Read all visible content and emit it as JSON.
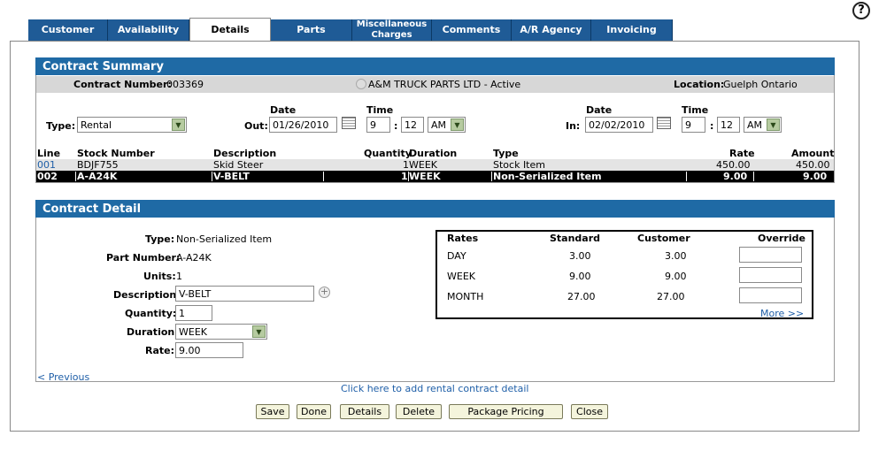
{
  "tabs": [
    {
      "label": "Customer"
    },
    {
      "label": "Availability"
    },
    {
      "label": "Details"
    },
    {
      "label": "Parts"
    },
    {
      "label_line1": "Miscellaneous",
      "label_line2": "Charges"
    },
    {
      "label": "Comments"
    },
    {
      "label": "A/R Agency"
    },
    {
      "label": "Invoicing"
    }
  ],
  "help_icon": "?",
  "summary": {
    "title": "Contract Summary",
    "contract_number_label": "Contract Number:",
    "contract_number": "003369",
    "customer": "A&M TRUCK PARTS LTD - Active",
    "location_label": "Location:",
    "location": "Guelph Ontario",
    "type_label": "Type:",
    "type_value": "Rental",
    "date_header": "Date",
    "time_header": "Time",
    "out_label": "Out:",
    "out_date": "01/26/2010",
    "out_hour": "9",
    "out_min": "12",
    "out_ampm": "AM",
    "in_label": "In:",
    "in_date": "02/02/2010",
    "in_hour": "9",
    "in_min": "12",
    "in_ampm": "AM",
    "colon": ":"
  },
  "lines": {
    "headers": {
      "line": "Line",
      "stock": "Stock Number",
      "desc": "Description",
      "qty": "Quantity",
      "duration": "Duration",
      "type": "Type",
      "rate": "Rate",
      "amount": "Amount"
    },
    "rows": [
      {
        "line": "001",
        "stock": "BDJF755",
        "desc": "Skid Steer",
        "qty": "1",
        "duration": "WEEK",
        "type": "Stock Item",
        "rate": "450.00",
        "amount": "450.00"
      },
      {
        "line": "002",
        "stock": "A-A24K",
        "desc": "V-BELT",
        "qty": "1",
        "duration": "WEEK",
        "type": "Non-Serialized Item",
        "rate": "9.00",
        "amount": "9.00"
      }
    ]
  },
  "detail": {
    "title": "Contract Detail",
    "type_label": "Type:",
    "type_value": "Non-Serialized Item",
    "part_label": "Part Number:",
    "part_value": "A-A24K",
    "units_label": "Units:",
    "units_value": "1",
    "desc_label": "Description:",
    "desc_value": "V-BELT",
    "qty_label": "Quantity:",
    "qty_value": "1",
    "duration_label": "Duration:",
    "duration_value": "WEEK",
    "rate_label": "Rate:",
    "rate_value": "9.00",
    "previous_link": "< Previous",
    "add_link": "Click here to add rental contract detail"
  },
  "rates": {
    "headers": {
      "rates": "Rates",
      "standard": "Standard",
      "customer": "Customer",
      "override": "Override"
    },
    "rows": [
      {
        "period": "DAY",
        "standard": "3.00",
        "customer": "3.00"
      },
      {
        "period": "WEEK",
        "standard": "9.00",
        "customer": "9.00"
      },
      {
        "period": "MONTH",
        "standard": "27.00",
        "customer": "27.00"
      }
    ],
    "more_link": "More >>"
  },
  "buttons": {
    "save": "Save",
    "done": "Done",
    "details": "Details",
    "delete": "Delete",
    "package_pricing": "Package Pricing",
    "close": "Close"
  }
}
